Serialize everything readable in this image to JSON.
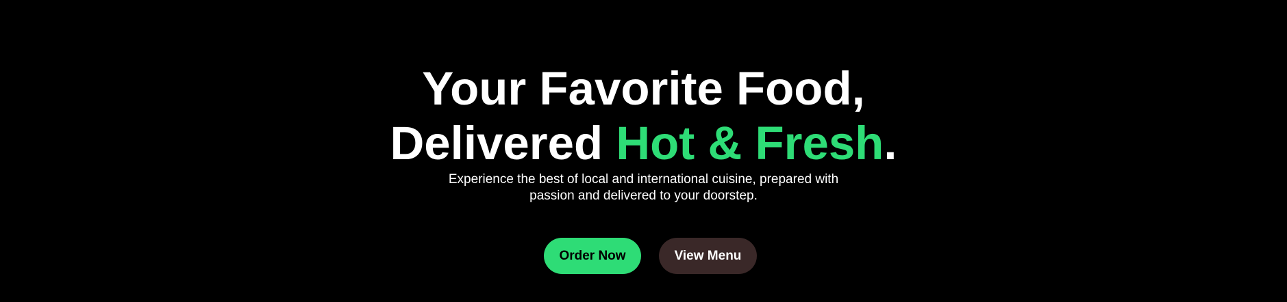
{
  "hero": {
    "headline_line1": "Your Favorite Food,",
    "headline_line2_start": "Delivered ",
    "headline_accent": "Hot & Fresh",
    "headline_end": ".",
    "subtitle_line1": "Experience the best of local and international cuisine, prepared with",
    "subtitle_line2": "passion and delivered to your doorstep."
  },
  "buttons": {
    "primary_label": "Order Now",
    "secondary_label": "View Menu"
  },
  "colors": {
    "background": "#000000",
    "accent": "#2edc76",
    "secondary_button": "#3a2828",
    "text": "#ffffff"
  }
}
